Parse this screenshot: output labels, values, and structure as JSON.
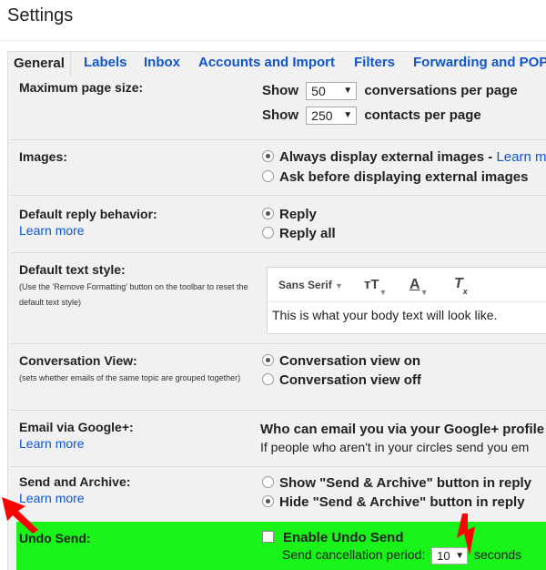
{
  "page": {
    "title": "Settings"
  },
  "tabs": [
    {
      "label": "General",
      "active": true
    },
    {
      "label": "Labels"
    },
    {
      "label": "Inbox"
    },
    {
      "label": "Accounts and Import"
    },
    {
      "label": "Filters"
    },
    {
      "label": "Forwarding and POP"
    }
  ],
  "max_page_size": {
    "label": "Maximum page size:",
    "show1": "Show",
    "conv_value": "50",
    "conv_suffix": "conversations per page",
    "show2": "Show",
    "contacts_value": "250",
    "contacts_suffix": "contacts per page"
  },
  "images": {
    "label": "Images:",
    "opt1": "Always display external images - ",
    "opt1_link": "Learn m",
    "opt2": "Ask before displaying external images",
    "selected": 1
  },
  "reply": {
    "label": "Default reply behavior:",
    "learn": "Learn more",
    "opt1": "Reply",
    "opt2": "Reply all",
    "selected": 1
  },
  "text_style": {
    "label": "Default text style:",
    "hint": "(Use the 'Remove Formatting' button on the toolbar to reset the default text style)",
    "font": "Sans Serif",
    "preview": "This is what your body text will look like."
  },
  "conversation": {
    "label": "Conversation View:",
    "hint": "(sets whether emails of the same topic are grouped together)",
    "opt1": "Conversation view on",
    "opt2": "Conversation view off",
    "selected": 1
  },
  "google_plus": {
    "label": "Email via Google+:",
    "learn": "Learn more",
    "line1": "Who can email you via your Google+ profile",
    "line2": "If people who aren't in your circles send you em"
  },
  "send_archive": {
    "label": "Send and Archive:",
    "learn": "Learn more",
    "opt1": "Show \"Send & Archive\" button in reply",
    "opt2": "Hide \"Send & Archive\" button in reply",
    "selected": 2
  },
  "undo_send": {
    "label": "Undo Send:",
    "checkbox": "Enable Undo Send",
    "period_label": "Send cancellation period:",
    "period_value": "10",
    "period_suffix": "seconds",
    "highlight_color": "#19f319"
  },
  "colors": {
    "link": "#1155cc",
    "annotation_arrow": "#ff0000"
  }
}
